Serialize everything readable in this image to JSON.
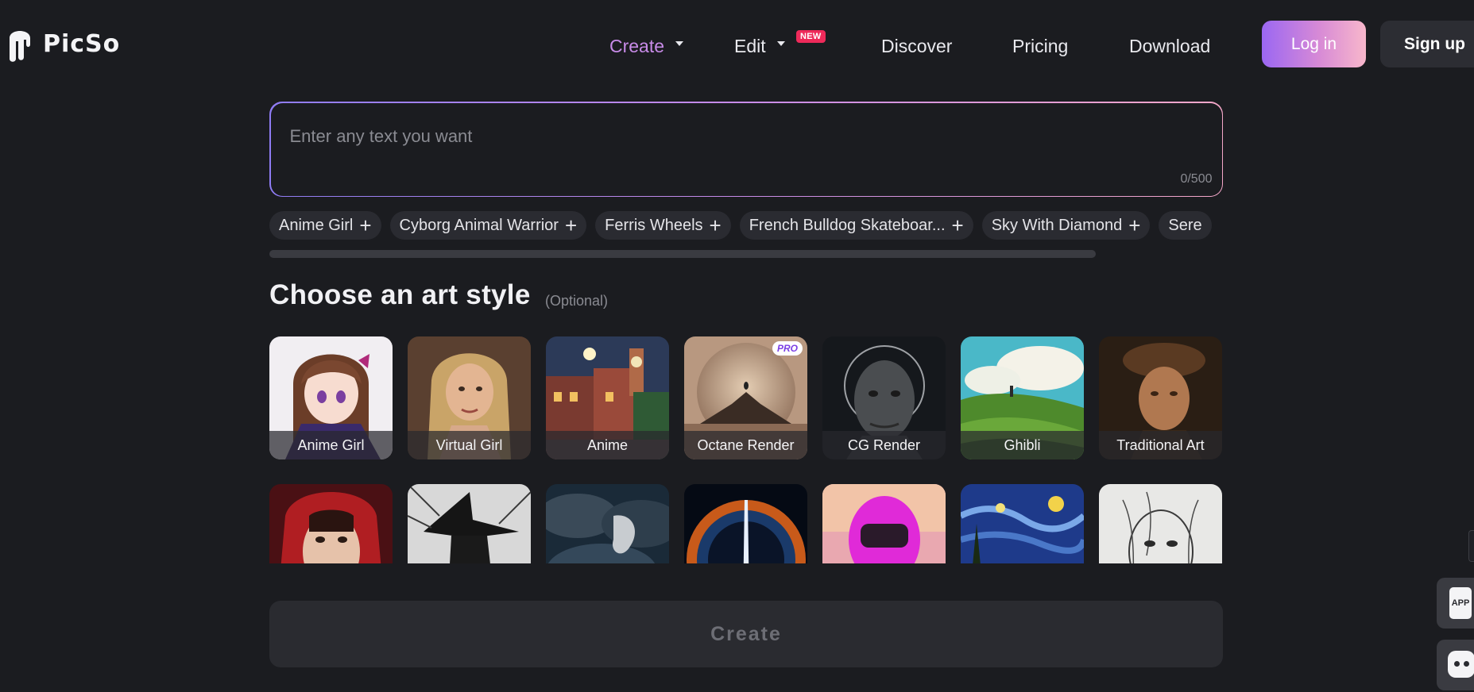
{
  "brand": {
    "name": "PicSo"
  },
  "nav": {
    "items": [
      {
        "id": "create",
        "label": "Create",
        "active": true,
        "has_dropdown": true
      },
      {
        "id": "edit",
        "label": "Edit",
        "active": false,
        "has_dropdown": true,
        "badge": "NEW"
      },
      {
        "id": "discover",
        "label": "Discover",
        "active": false
      },
      {
        "id": "pricing",
        "label": "Pricing",
        "active": false
      },
      {
        "id": "download",
        "label": "Download",
        "active": false
      }
    ],
    "login_label": "Log in",
    "signup_label": "Sign up"
  },
  "prompt": {
    "placeholder": "Enter any text you want",
    "value": "",
    "char_count": "0/500"
  },
  "suggestions": [
    "Anime Girl",
    "Cyborg Animal Warrior",
    "Ferris Wheels",
    "French Bulldog Skateboar...",
    "Sky With Diamond",
    "Sere"
  ],
  "styles_section": {
    "title": "Choose an art style",
    "optional": "(Optional)"
  },
  "styles": [
    {
      "label": "Anime Girl",
      "icon": "anime-girl-thumbnail"
    },
    {
      "label": "Virtual Girl",
      "icon": "virtual-girl-thumbnail"
    },
    {
      "label": "Anime",
      "icon": "anime-thumbnail"
    },
    {
      "label": "Octane Render",
      "icon": "octane-render-thumbnail",
      "badge": "PRO"
    },
    {
      "label": "CG Render",
      "icon": "cg-render-thumbnail"
    },
    {
      "label": "Ghibli",
      "icon": "ghibli-thumbnail"
    },
    {
      "label": "Traditional Art",
      "icon": "traditional-art-thumbnail"
    },
    {
      "label": "",
      "icon": "red-hood-thumbnail"
    },
    {
      "label": "",
      "icon": "witch-thumbnail"
    },
    {
      "label": "",
      "icon": "dragon-thumbnail"
    },
    {
      "label": "",
      "icon": "cosmic-thumbnail"
    },
    {
      "label": "",
      "icon": "pink-helmet-thumbnail"
    },
    {
      "label": "",
      "icon": "starry-night-thumbnail"
    },
    {
      "label": "",
      "icon": "sketch-thumbnail"
    }
  ],
  "create_button": {
    "label": "Create"
  },
  "floating": {
    "app_label": "APP"
  },
  "colors": {
    "background": "#1b1c20",
    "accent_start": "#9b67f2",
    "accent_end": "#f8b7cb",
    "active_nav": "#c88be8",
    "new_badge": "#ee2a5a"
  }
}
